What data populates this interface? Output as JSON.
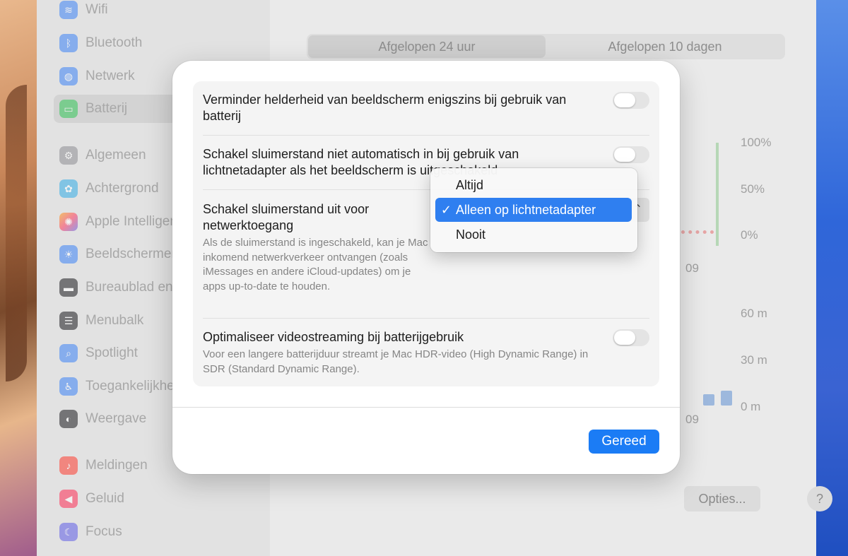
{
  "sidebar": {
    "items": [
      {
        "label": "Wifi",
        "icon": "wifi-icon",
        "color": "#3b82f6"
      },
      {
        "label": "Bluetooth",
        "icon": "bluetooth-icon",
        "color": "#3b82f6"
      },
      {
        "label": "Netwerk",
        "icon": "globe-icon",
        "color": "#3b82f6"
      },
      {
        "label": "Batterij",
        "icon": "battery-icon",
        "color": "#34c759"
      },
      {
        "label": "Algemeen",
        "icon": "gear-icon",
        "color": "#8e8e93"
      },
      {
        "label": "Achtergrond",
        "icon": "flower-icon",
        "color": "#32ade6"
      },
      {
        "label": "Apple Intelligence",
        "icon": "sparkle-icon",
        "color": "#ff6f61"
      },
      {
        "label": "Beeldschermen",
        "icon": "sun-icon",
        "color": "#3b82f6"
      },
      {
        "label": "Bureaublad en",
        "icon": "desktop-icon",
        "color": "#1c1c1e"
      },
      {
        "label": "Menubalk",
        "icon": "menubar-icon",
        "color": "#1c1c1e"
      },
      {
        "label": "Spotlight",
        "icon": "search-icon",
        "color": "#3b82f6"
      },
      {
        "label": "Toegankelijkheid",
        "icon": "accessibility-icon",
        "color": "#3b82f6"
      },
      {
        "label": "Weergave",
        "icon": "appearance-icon",
        "color": "#1c1c1e"
      },
      {
        "label": "Meldingen",
        "icon": "bell-icon",
        "color": "#ff3b30"
      },
      {
        "label": "Geluid",
        "icon": "speaker-icon",
        "color": "#ff2d55"
      },
      {
        "label": "Focus",
        "icon": "moon-icon",
        "color": "#5e5ce6"
      }
    ]
  },
  "main": {
    "segments": [
      "Afgelopen 24 uur",
      "Afgelopen 10 dagen"
    ],
    "battery_axis": [
      "100%",
      "50%",
      "0%"
    ],
    "time_axis": [
      "60 m",
      "30 m",
      "0 m"
    ],
    "x_label_top": "09",
    "x_label_bottom": "09",
    "options_label": "Opties...",
    "help_label": "?"
  },
  "sheet": {
    "rows": [
      {
        "title": "Verminder helderheid van beeldscherm enigszins bij gebruik van batterij",
        "description": "",
        "control": "toggle",
        "on": false
      },
      {
        "title": "Schakel sluimerstand niet automatisch in bij gebruik van lichtnetadapter als het beeldscherm is uitgeschakeld",
        "description": "",
        "control": "toggle",
        "on": false
      },
      {
        "title": "Schakel sluimerstand uit voor netwerktoegang",
        "description": "Als de sluimerstand is ingeschakeld, kan je Mac inkomend netwerkverkeer ontvangen (zoals iMessages en andere iCloud-updates) om je apps up-to-date te houden.",
        "control": "popup"
      },
      {
        "title": "Optimaliseer videostreaming bij batterijgebruik",
        "description": "Voor een langere batterijduur streamt je Mac HDR-video (High Dynamic Range) in SDR (Standard Dynamic Range).",
        "control": "toggle",
        "on": false
      }
    ],
    "done_label": "Gereed"
  },
  "menu": {
    "items": [
      {
        "label": "Altijd",
        "checked": false
      },
      {
        "label": "Alleen op lichtnetadapter",
        "checked": true
      },
      {
        "label": "Nooit",
        "checked": false
      }
    ],
    "check_glyph": "✓"
  },
  "colors": {
    "accent": "#1b7cf5",
    "menu_highlight": "#2f7ff0"
  }
}
